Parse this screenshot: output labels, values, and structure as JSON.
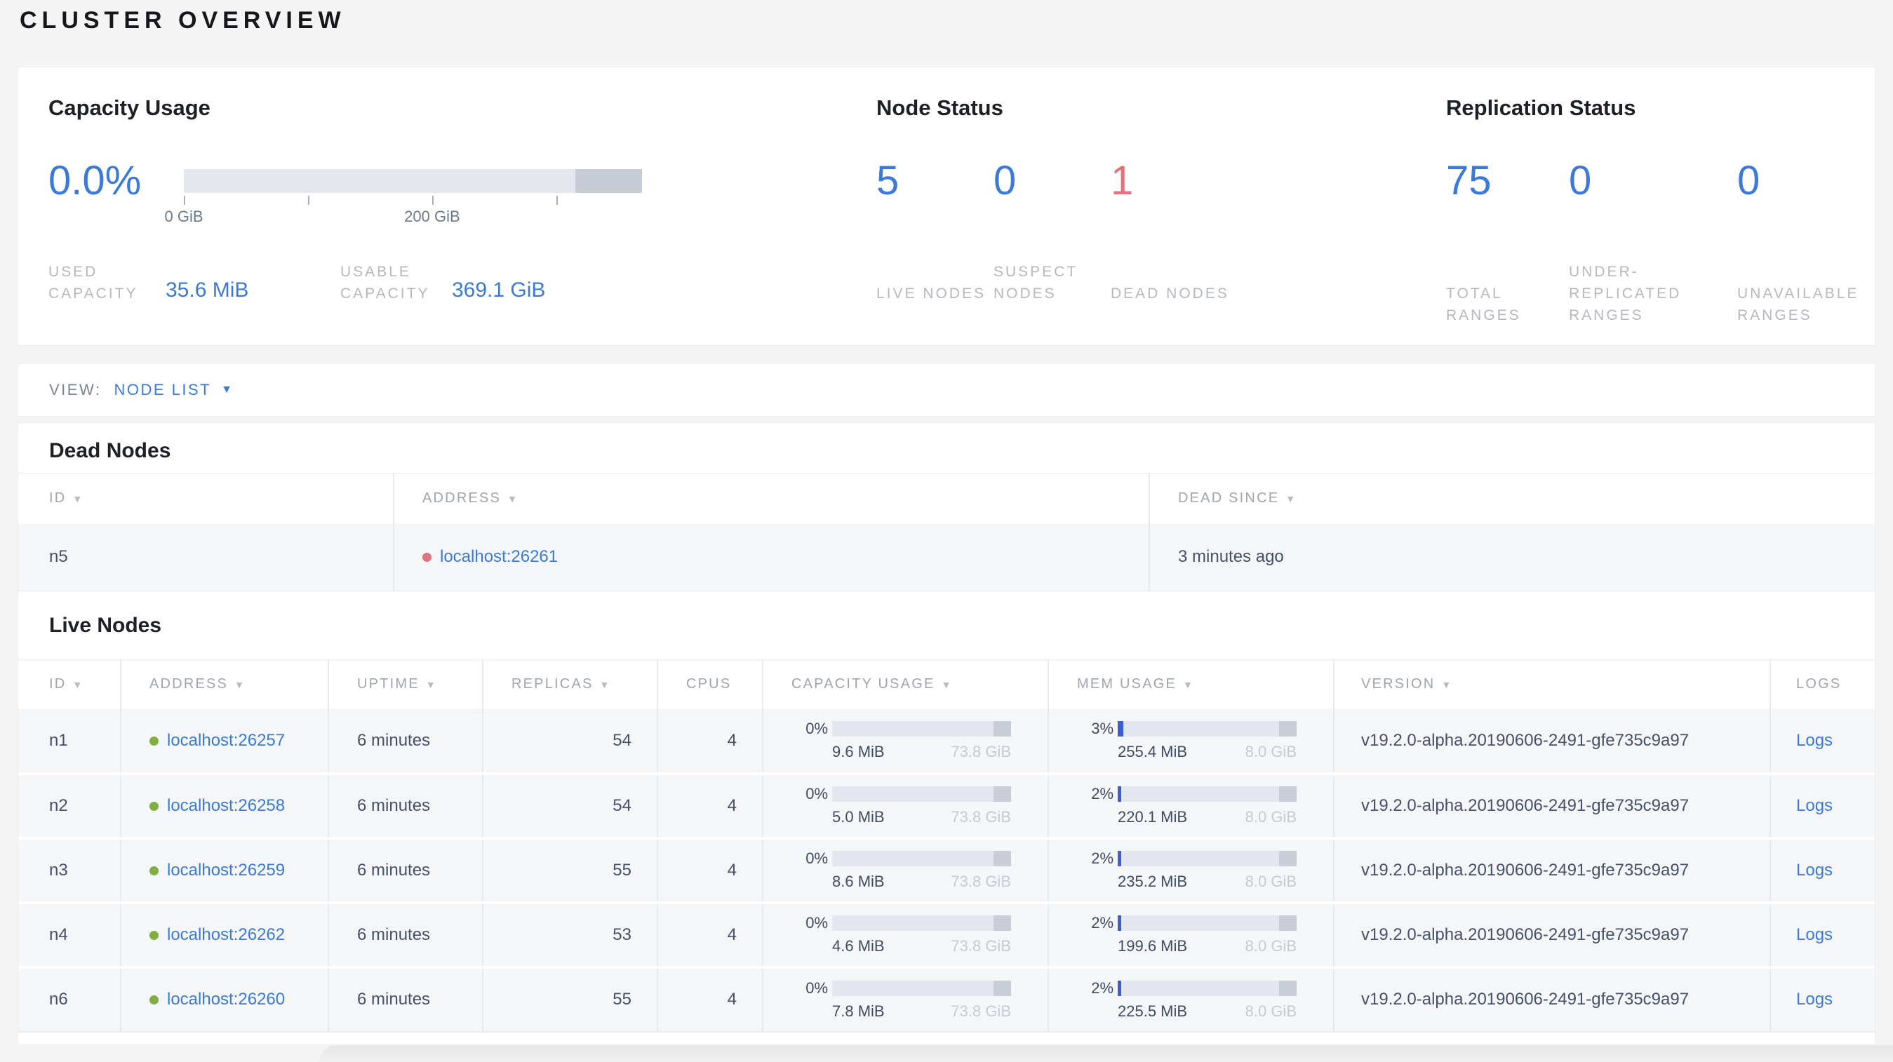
{
  "title": "CLUSTER OVERVIEW",
  "icons": {
    "sort_desc": "▼",
    "dropdown": "▼"
  },
  "colors": {
    "accent_blue": "#3b7ad6",
    "bar_blue": "#3b5fd1",
    "dead_red": "#df737e",
    "live_green": "#7fae42"
  },
  "overview": {
    "capacity": {
      "heading": "Capacity Usage",
      "percent": "0.0%",
      "bar_used_pct": 0,
      "bar_reserved_pct": 14.6,
      "axis": {
        "tick1_label": "0 GiB",
        "tick2_label": "200 GiB"
      },
      "used_label": "USED CAPACITY",
      "used_value": "35.6 MiB",
      "usable_label": "USABLE CAPACITY",
      "usable_value": "369.1 GiB"
    },
    "node_status": {
      "heading": "Node Status",
      "stats": [
        {
          "value": "5",
          "label": "LIVE NODES",
          "state": "live"
        },
        {
          "value": "0",
          "label": "SUSPECT NODES",
          "state": "suspect"
        },
        {
          "value": "1",
          "label": "DEAD NODES",
          "state": "dead"
        }
      ]
    },
    "replication_status": {
      "heading": "Replication Status",
      "stats": [
        {
          "value": "75",
          "label": "TOTAL RANGES"
        },
        {
          "value": "0",
          "label": "UNDER-REPLICATED RANGES"
        },
        {
          "value": "0",
          "label": "UNAVAILABLE RANGES"
        }
      ]
    }
  },
  "view_bar": {
    "label": "VIEW:",
    "selected": "NODE LIST"
  },
  "dead_nodes": {
    "heading": "Dead Nodes",
    "columns": {
      "id": "ID",
      "address": "ADDRESS",
      "dead_since": "DEAD SINCE"
    },
    "rows": [
      {
        "id": "n5",
        "address": "localhost:26261",
        "dead_since": "3 minutes ago",
        "status": "dead"
      }
    ]
  },
  "live_nodes": {
    "heading": "Live Nodes",
    "columns": {
      "id": "ID",
      "address": "ADDRESS",
      "uptime": "UPTIME",
      "replicas": "REPLICAS",
      "cpus": "CPUS",
      "capacity": "CAPACITY USAGE",
      "memory": "MEM USAGE",
      "version": "VERSION",
      "logs": "LOGS"
    },
    "rows": [
      {
        "id": "n1",
        "address": "localhost:26257",
        "uptime": "6 minutes",
        "replicas": "54",
        "cpus": "4",
        "cap_pct": "0%",
        "cap_pct_num": 0,
        "cap_used": "9.6 MiB",
        "cap_total": "73.8 GiB",
        "mem_pct": "3%",
        "mem_pct_num": 3,
        "mem_used": "255.4 MiB",
        "mem_total": "8.0 GiB",
        "version": "v19.2.0-alpha.20190606-2491-gfe735c9a97",
        "logs": "Logs",
        "status": "live"
      },
      {
        "id": "n2",
        "address": "localhost:26258",
        "uptime": "6 minutes",
        "replicas": "54",
        "cpus": "4",
        "cap_pct": "0%",
        "cap_pct_num": 0,
        "cap_used": "5.0 MiB",
        "cap_total": "73.8 GiB",
        "mem_pct": "2%",
        "mem_pct_num": 2,
        "mem_used": "220.1 MiB",
        "mem_total": "8.0 GiB",
        "version": "v19.2.0-alpha.20190606-2491-gfe735c9a97",
        "logs": "Logs",
        "status": "live"
      },
      {
        "id": "n3",
        "address": "localhost:26259",
        "uptime": "6 minutes",
        "replicas": "55",
        "cpus": "4",
        "cap_pct": "0%",
        "cap_pct_num": 0,
        "cap_used": "8.6 MiB",
        "cap_total": "73.8 GiB",
        "mem_pct": "2%",
        "mem_pct_num": 2,
        "mem_used": "235.2 MiB",
        "mem_total": "8.0 GiB",
        "version": "v19.2.0-alpha.20190606-2491-gfe735c9a97",
        "logs": "Logs",
        "status": "live"
      },
      {
        "id": "n4",
        "address": "localhost:26262",
        "uptime": "6 minutes",
        "replicas": "53",
        "cpus": "4",
        "cap_pct": "0%",
        "cap_pct_num": 0,
        "cap_used": "4.6 MiB",
        "cap_total": "73.8 GiB",
        "mem_pct": "2%",
        "mem_pct_num": 2,
        "mem_used": "199.6 MiB",
        "mem_total": "8.0 GiB",
        "version": "v19.2.0-alpha.20190606-2491-gfe735c9a97",
        "logs": "Logs",
        "status": "live"
      },
      {
        "id": "n6",
        "address": "localhost:26260",
        "uptime": "6 minutes",
        "replicas": "55",
        "cpus": "4",
        "cap_pct": "0%",
        "cap_pct_num": 0,
        "cap_used": "7.8 MiB",
        "cap_total": "73.8 GiB",
        "mem_pct": "2%",
        "mem_pct_num": 2,
        "mem_used": "225.5 MiB",
        "mem_total": "8.0 GiB",
        "version": "v19.2.0-alpha.20190606-2491-gfe735c9a97",
        "logs": "Logs",
        "status": "live"
      }
    ]
  }
}
